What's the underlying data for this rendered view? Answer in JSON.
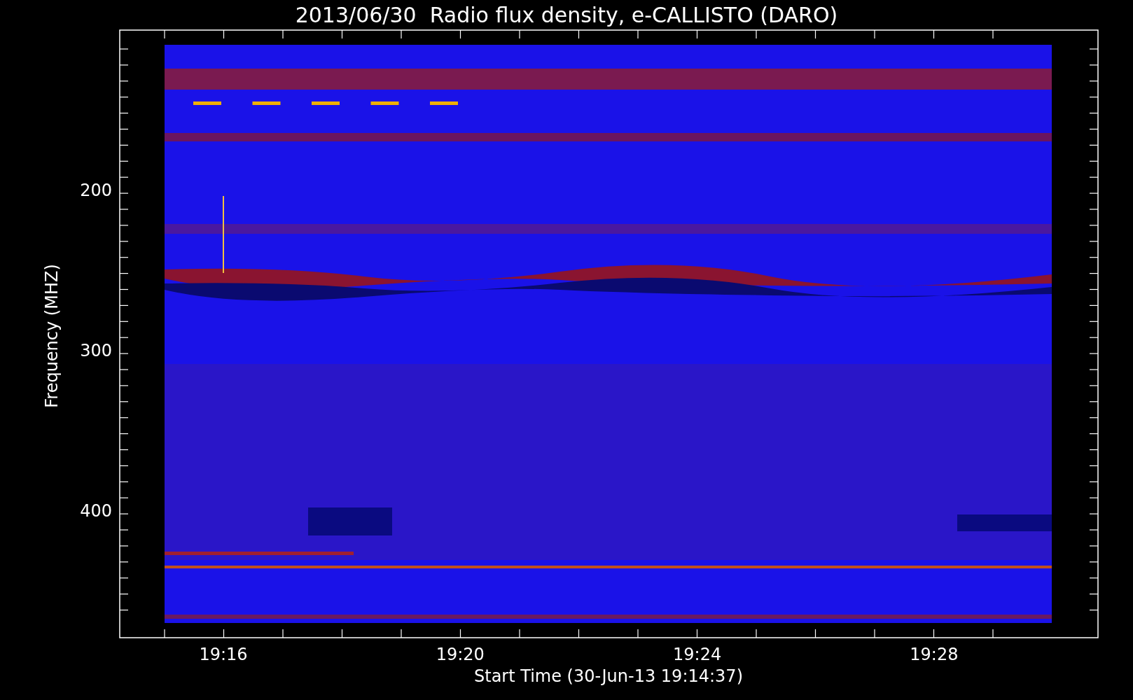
{
  "title": "2013/06/30  Radio flux density, e-CALLISTO (DARO)",
  "plot": {
    "ylabel": "Frequency (MHZ)",
    "xlabel": "Start Time (30-Jun-13 19:14:37)",
    "yticks": [
      "200",
      "300",
      "400"
    ],
    "xticks": [
      "19:16",
      "19:20",
      "19:24",
      "19:28"
    ]
  }
}
